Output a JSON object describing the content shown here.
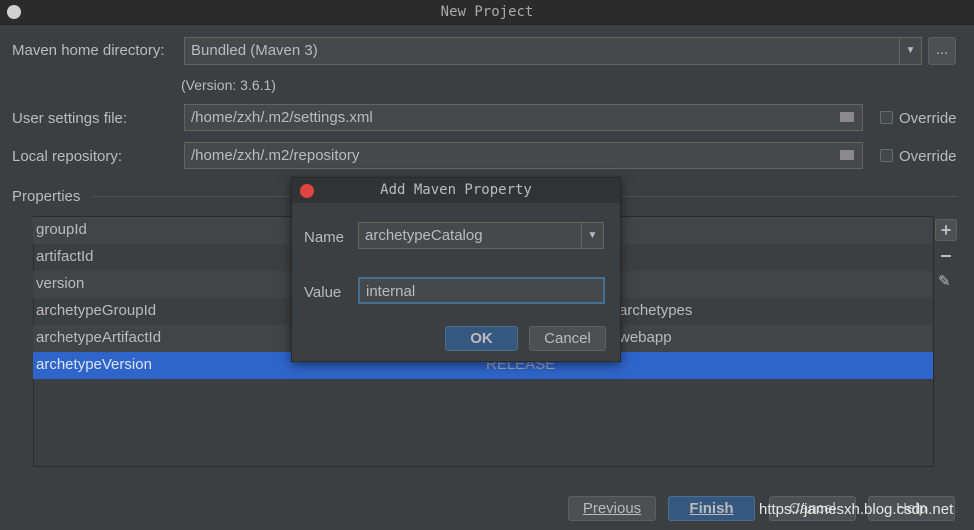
{
  "window": {
    "title": "New Project"
  },
  "maven_home": {
    "label": "Maven home directory:",
    "value": "Bundled (Maven 3)",
    "browse": "...",
    "version": "(Version: 3.6.1)"
  },
  "user_settings": {
    "label": "User settings file:",
    "value": "/home/zxh/.m2/settings.xml",
    "override": "Override",
    "override_checked": false
  },
  "local_repo": {
    "label": "Local repository:",
    "value": "/home/zxh/.m2/repository",
    "override": "Override",
    "override_checked": false
  },
  "properties": {
    "label": "Properties",
    "rows": [
      {
        "name": "groupId",
        "value": ""
      },
      {
        "name": "artifactId",
        "value": ""
      },
      {
        "name": "version",
        "value": ""
      },
      {
        "name": "archetypeGroupId",
        "value": "archetypes"
      },
      {
        "name": "archetypeArtifactId",
        "value": "webapp"
      },
      {
        "name": "archetypeVersion",
        "value": "RELEASE"
      }
    ],
    "selected": "archetypeVersion"
  },
  "dialog": {
    "title": "Add Maven Property",
    "name_label": "Name",
    "name_value": "archetypeCatalog",
    "value_label": "Value",
    "value_value": "internal",
    "ok": "OK",
    "cancel": "Cancel"
  },
  "footer": {
    "previous": "Previous",
    "finish": "Finish",
    "cancel": "Cancel",
    "help": "Help"
  },
  "watermark": "https://jamesxh.blog.csdn.net",
  "colors": {
    "background": "#3c3f41",
    "selection": "#2f65ca",
    "default_button": "#365880",
    "close_dot": "#e0443e"
  }
}
